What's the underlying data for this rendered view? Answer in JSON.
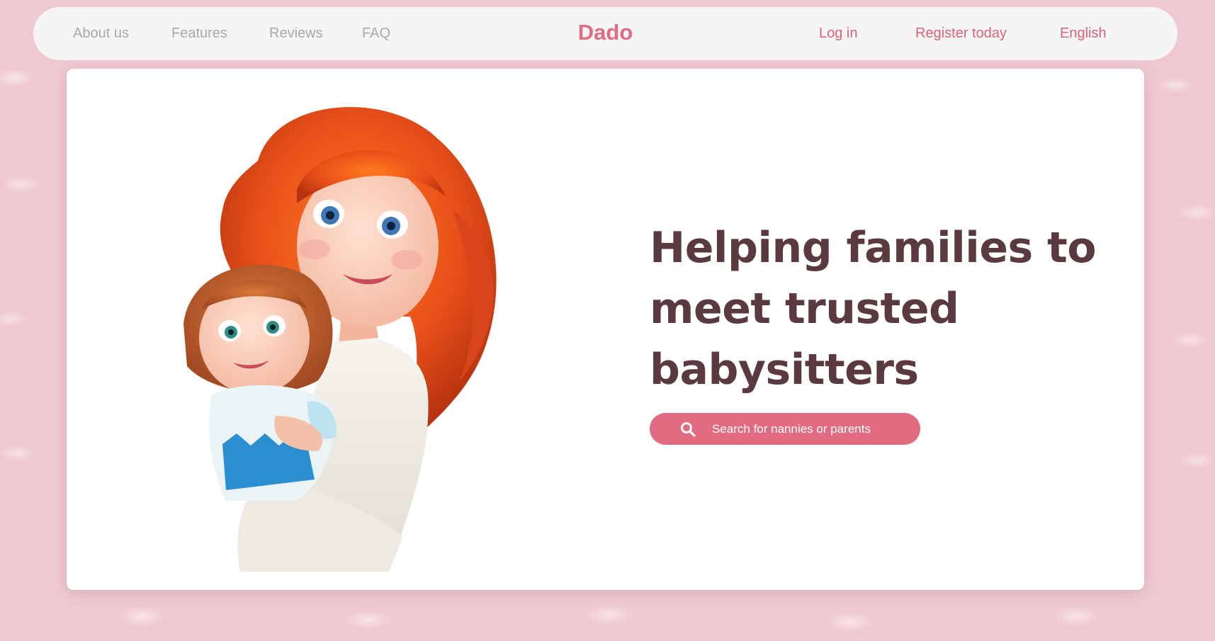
{
  "nav": {
    "about": "About us",
    "features": "Features",
    "reviews": "Reviews",
    "faq": "FAQ",
    "logo": "Dado",
    "login": "Log in",
    "register": "Register today",
    "language": "English"
  },
  "hero": {
    "headline": "Helping families to meet trusted babysitters",
    "search_label": "Search for nannies or parents",
    "illustration": "mother-and-daughter-illustration"
  },
  "colors": {
    "accent": "#e16b80",
    "logo": "#e06c84",
    "headline": "#5a3a3e",
    "nav_muted": "#a9a9a9",
    "background": "#efc9d1",
    "navbar": "#f5f5f5",
    "card": "#ffffff"
  },
  "icons": {
    "search": "search-icon"
  }
}
